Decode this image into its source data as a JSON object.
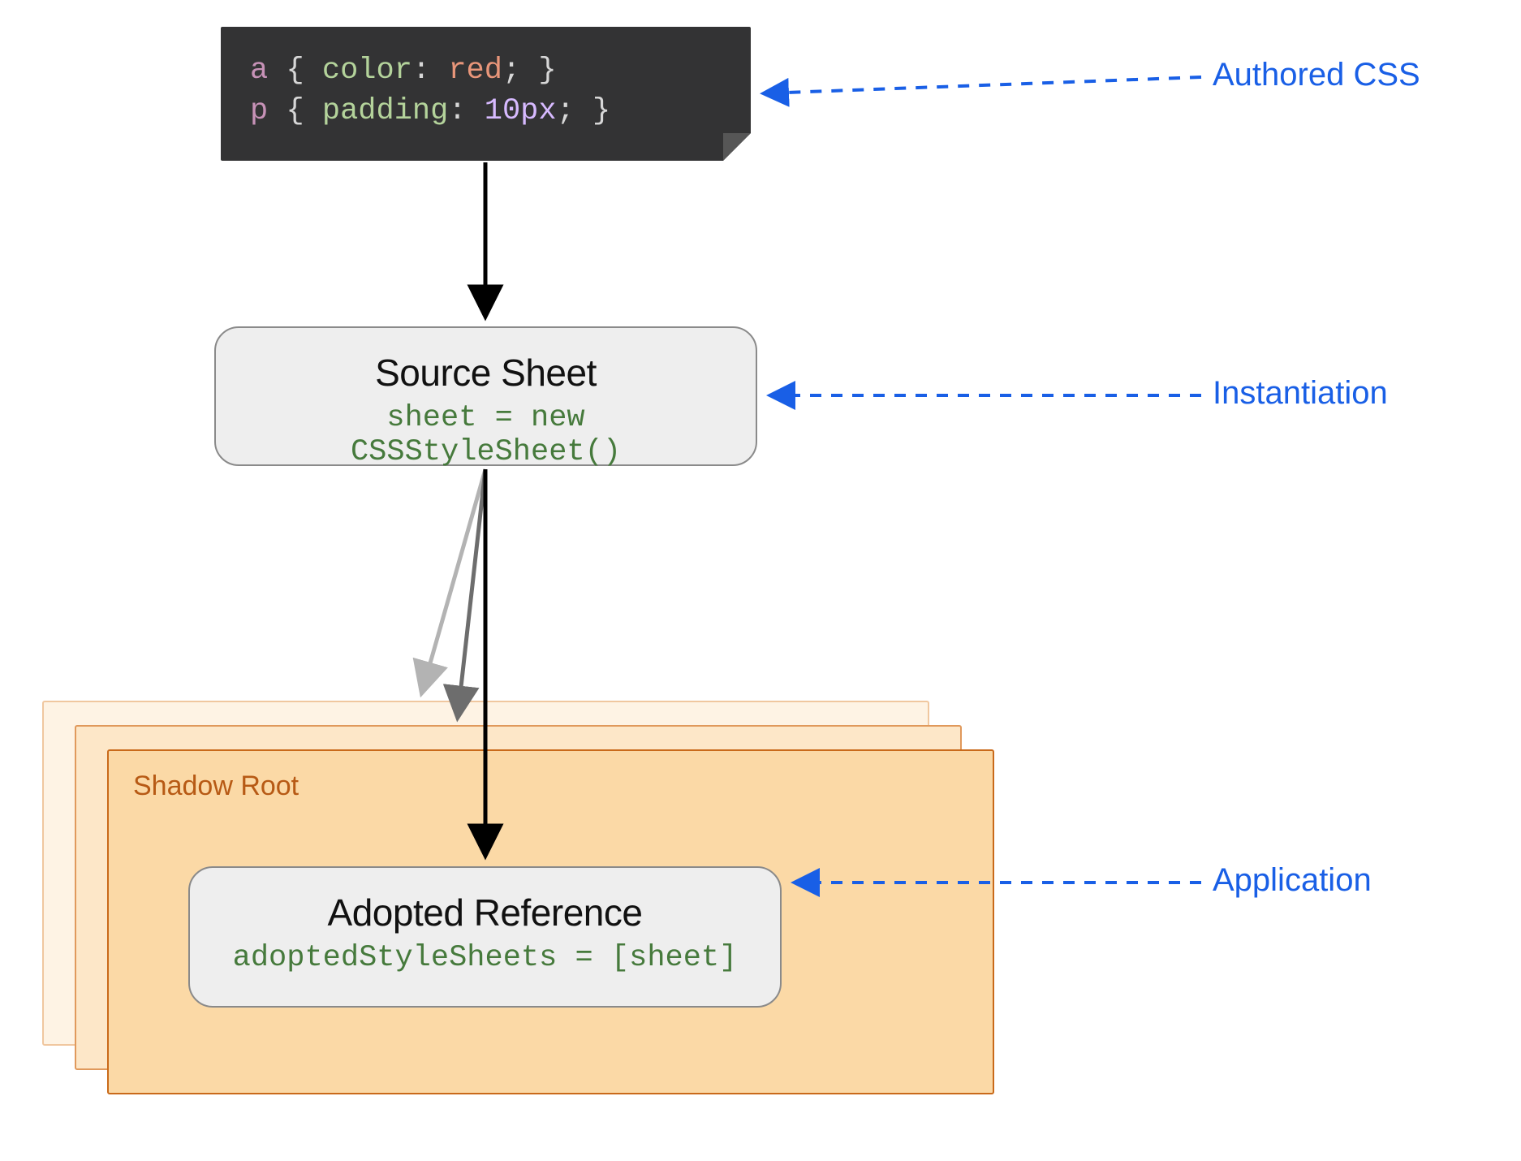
{
  "code": {
    "line1": {
      "selector": "a",
      "brace_open": "{",
      "prop": "color",
      "colon": ":",
      "value": "red",
      "semi": ";",
      "brace_close": "}"
    },
    "line2": {
      "selector": "p",
      "brace_open": "{",
      "prop": "padding",
      "colon": ":",
      "value": "10px",
      "semi": ";",
      "brace_close": "}"
    }
  },
  "boxes": {
    "source": {
      "title": "Source Sheet",
      "code": "sheet = new CSSStyleSheet()"
    },
    "adopted": {
      "title": "Adopted Reference",
      "code": "adoptedStyleSheets = [sheet]"
    }
  },
  "shadow": {
    "label": "Shadow Root"
  },
  "annotations": {
    "authored": "Authored CSS",
    "instantiation": "Instantiation",
    "application": "Application"
  },
  "colors": {
    "annotation": "#195fe6",
    "code_bg": "#333334",
    "box_bg": "#eeeeee",
    "box_border": "#8a8a8a",
    "shadow_border_front": "#c96a1a",
    "shadow_fill_front": "#fbd9a6",
    "shadow_border_mid": "#e0995c",
    "shadow_fill_mid": "#fde7c8",
    "shadow_border_back": "#f0c79f",
    "shadow_fill_back": "#fef3e4",
    "code_green": "#467a3c"
  }
}
